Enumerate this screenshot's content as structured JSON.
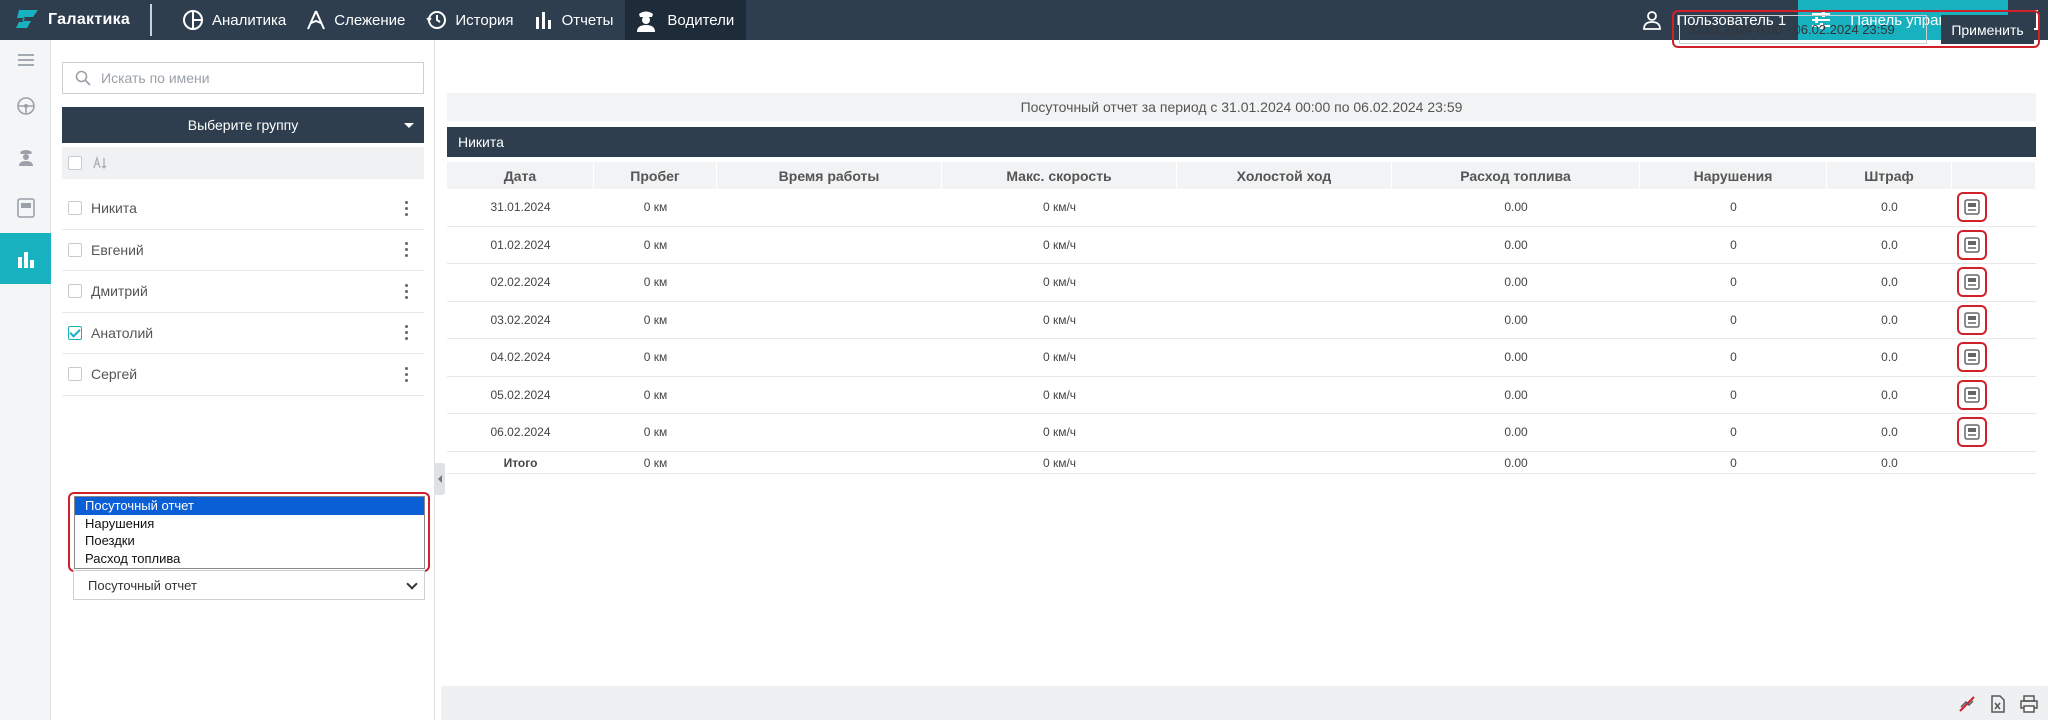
{
  "header": {
    "logo": "Галактика",
    "nav": [
      "Аналитика",
      "Слежение",
      "История",
      "Отчеты",
      "Водители"
    ],
    "user": "Пользователь 1",
    "panel": "Панель управления"
  },
  "left": {
    "search_placeholder": "Искать по имени",
    "group_button": "Выберите группу",
    "drivers": [
      {
        "name": "Никита",
        "checked": false
      },
      {
        "name": "Евгений",
        "checked": false
      },
      {
        "name": "Дмитрий",
        "checked": false
      },
      {
        "name": "Анатолий",
        "checked": true
      },
      {
        "name": "Сергей",
        "checked": false
      }
    ],
    "report_options": [
      "Посуточный отчет",
      "Нарушения",
      "Поездки",
      "Расход топлива"
    ],
    "report_selected": "Посуточный отчет"
  },
  "main": {
    "date_range": "31.01.2024 0:00 - 06.02.2024 23:59",
    "apply": "Применить",
    "period_title": "Посуточный отчет за период с 31.01.2024 00:00 по 06.02.2024 23:59",
    "driver_name": "Никита",
    "columns": [
      "Дата",
      "Пробег",
      "Время работы",
      "Макс. скорость",
      "Холостой ход",
      "Расход топлива",
      "Нарушения",
      "Штраф",
      ""
    ],
    "rows": [
      [
        "31.01.2024",
        "0 км",
        "",
        "0 км/ч",
        "",
        "0.00",
        "0",
        "0.0"
      ],
      [
        "01.02.2024",
        "0 км",
        "",
        "0 км/ч",
        "",
        "0.00",
        "0",
        "0.0"
      ],
      [
        "02.02.2024",
        "0 км",
        "",
        "0 км/ч",
        "",
        "0.00",
        "0",
        "0.0"
      ],
      [
        "03.02.2024",
        "0 км",
        "",
        "0 км/ч",
        "",
        "0.00",
        "0",
        "0.0"
      ],
      [
        "04.02.2024",
        "0 км",
        "",
        "0 км/ч",
        "",
        "0.00",
        "0",
        "0.0"
      ],
      [
        "05.02.2024",
        "0 км",
        "",
        "0 км/ч",
        "",
        "0.00",
        "0",
        "0.0"
      ],
      [
        "06.02.2024",
        "0 км",
        "",
        "0 км/ч",
        "",
        "0.00",
        "0",
        "0.0"
      ]
    ],
    "total": [
      "Итого",
      "0 км",
      "",
      "0 км/ч",
      "",
      "0.00",
      "0",
      "0.0"
    ]
  }
}
